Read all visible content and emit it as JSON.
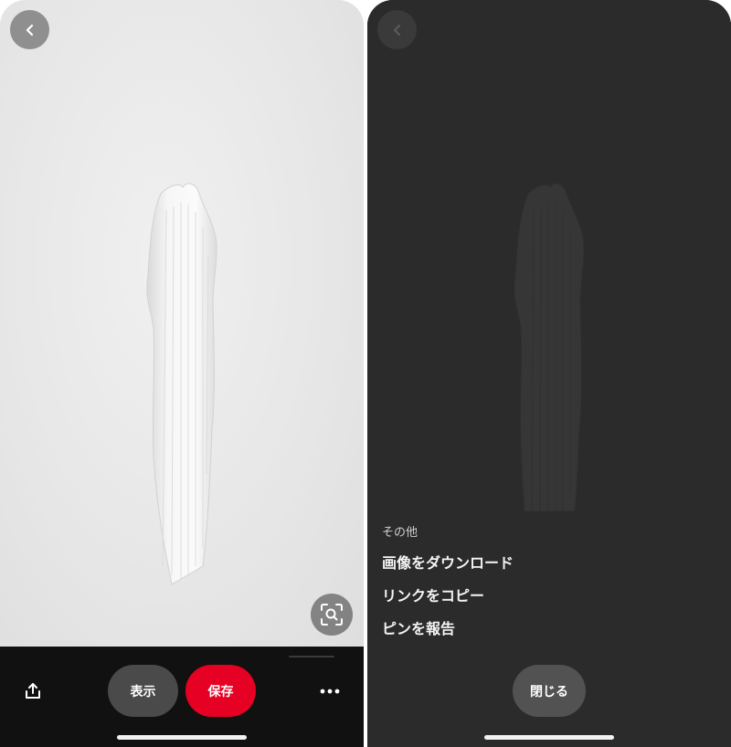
{
  "left_screen": {
    "buttons": {
      "back_icon": "chevron-left-icon",
      "lens_icon": "visual-search-icon",
      "share_icon": "share-icon",
      "view_label": "表示",
      "save_label": "保存",
      "more_icon": "more-icon"
    }
  },
  "right_screen": {
    "sheet": {
      "title": "その他",
      "items": [
        {
          "label": "画像をダウンロード"
        },
        {
          "label": "リンクをコピー"
        },
        {
          "label": "ピンを報告"
        }
      ],
      "close_label": "閉じる"
    }
  },
  "colors": {
    "accent": "#e60023",
    "bar_background": "#111111",
    "sheet_background": "#2b2b2b"
  }
}
